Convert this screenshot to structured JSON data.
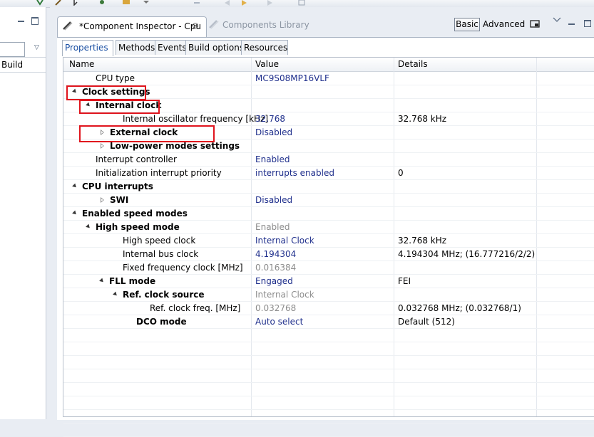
{
  "left_panel": {
    "build_label": "Build"
  },
  "editor_tabs": [
    {
      "label": "*Component Inspector - Cpu",
      "active": true,
      "close_glyph": "⊘"
    },
    {
      "label": "Components Library",
      "active": false
    }
  ],
  "view_mode": {
    "basic_label": "Basic",
    "advanced_label": "Advanced"
  },
  "sub_tabs": [
    "Properties",
    "Methods",
    "Events",
    "Build options",
    "Resources"
  ],
  "table": {
    "columns": [
      "Name",
      "Value",
      "Details"
    ],
    "rows": [
      {
        "indent": 1,
        "expander": "none",
        "name": "CPU type",
        "bold": false,
        "value": "MC9S08MP16VLF",
        "value_grey": false,
        "details": ""
      },
      {
        "indent": 0,
        "expander": "open",
        "name": "Clock settings",
        "bold": true,
        "value": "",
        "value_grey": false,
        "details": ""
      },
      {
        "indent": 1,
        "expander": "open",
        "name": "Internal clock",
        "bold": true,
        "value": "",
        "value_grey": false,
        "details": ""
      },
      {
        "indent": 3,
        "expander": "none",
        "name": "Internal oscillator frequency [kHz]",
        "bold": false,
        "value": "32.768",
        "value_grey": false,
        "details": "32.768 kHz"
      },
      {
        "indent": 1,
        "expander": "closed",
        "name": "External clock",
        "bold": true,
        "value": "Disabled",
        "value_grey": false,
        "details": ""
      },
      {
        "indent": 1,
        "expander": "closed",
        "name": "Low-power modes settings",
        "bold": true,
        "value": "",
        "value_grey": false,
        "details": ""
      },
      {
        "indent": 1,
        "expander": "none",
        "name": "Interrupt controller",
        "bold": false,
        "value": "Enabled",
        "value_grey": false,
        "details": ""
      },
      {
        "indent": 1,
        "expander": "none",
        "name": "Initialization interrupt priority",
        "bold": false,
        "value": "interrupts enabled",
        "value_grey": false,
        "details": "0"
      },
      {
        "indent": 0,
        "expander": "open",
        "name": "CPU interrupts",
        "bold": true,
        "value": "",
        "value_grey": false,
        "details": ""
      },
      {
        "indent": 1,
        "expander": "closed",
        "name": "SWI",
        "bold": true,
        "value": "Disabled",
        "value_grey": false,
        "details": ""
      },
      {
        "indent": 0,
        "expander": "open",
        "name": "Enabled speed modes",
        "bold": true,
        "value": "",
        "value_grey": false,
        "details": ""
      },
      {
        "indent": 1,
        "expander": "open",
        "name": "High speed mode",
        "bold": true,
        "value": "Enabled",
        "value_grey": true,
        "details": ""
      },
      {
        "indent": 3,
        "expander": "none",
        "name": "High speed clock",
        "bold": false,
        "value": "Internal Clock",
        "value_grey": false,
        "details": "32.768 kHz"
      },
      {
        "indent": 3,
        "expander": "none",
        "name": "Internal bus clock",
        "bold": false,
        "value": "4.194304",
        "value_grey": false,
        "details": "4.194304 MHz; (16.777216/2/2)"
      },
      {
        "indent": 3,
        "expander": "none",
        "name": "Fixed frequency clock [MHz]",
        "bold": false,
        "value": "0.016384",
        "value_grey": true,
        "details": ""
      },
      {
        "indent": 2,
        "expander": "open",
        "name": "FLL mode",
        "bold": true,
        "value": "Engaged",
        "value_grey": false,
        "details": "FEI"
      },
      {
        "indent": 3,
        "expander": "open",
        "name": "Ref. clock source",
        "bold": true,
        "value": "Internal Clock",
        "value_grey": true,
        "details": ""
      },
      {
        "indent": 5,
        "expander": "none",
        "name": "Ref. clock freq. [MHz]",
        "bold": false,
        "value": "0.032768",
        "value_grey": true,
        "details": "0.032768 MHz; (0.032768/1)"
      },
      {
        "indent": 4,
        "expander": "none",
        "name": "DCO mode",
        "bold": true,
        "value": "Auto select",
        "value_grey": false,
        "details": "Default (512)"
      }
    ],
    "empty_rows": 8
  },
  "colors": {
    "highlight_box": "#e0141d",
    "value_text": "#1f2f8c",
    "active_tab_text": "#1a4fa3"
  }
}
